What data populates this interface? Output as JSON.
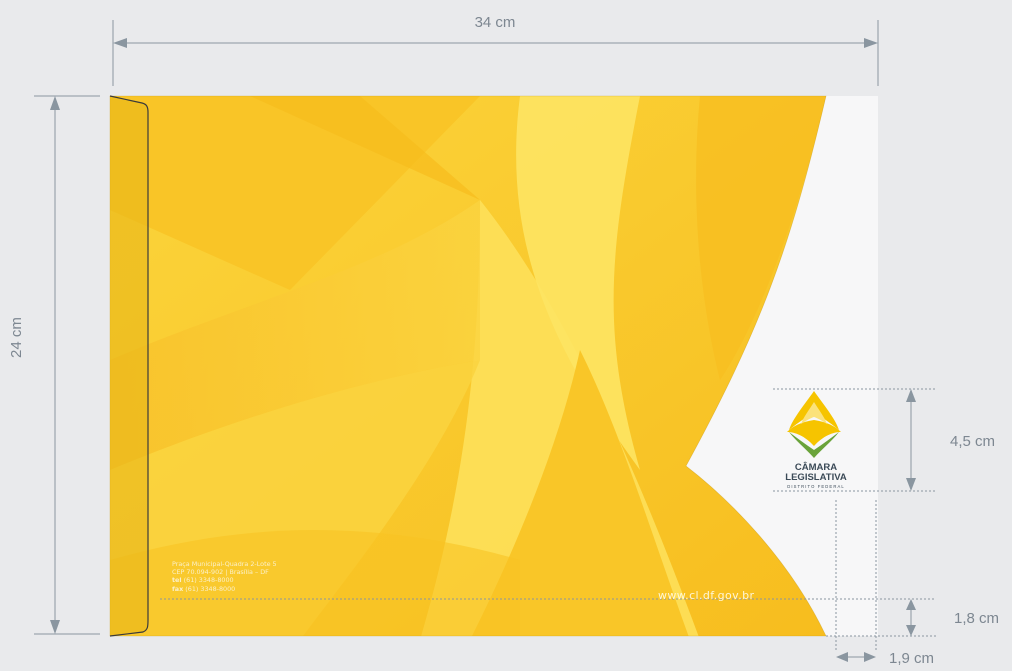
{
  "dimensions": {
    "width_label": "34 cm",
    "height_label": "24 cm",
    "logo_height_label": "4,5 cm",
    "bottom_margin_label": "1,8 cm",
    "right_margin_label": "1,9 cm"
  },
  "envelope": {
    "address_line1": "Praça Municipal-Quadra 2-Lote 5",
    "address_line2": "CEP 70.094-902 | Brasília – DF",
    "tel_label": "tel",
    "tel_value": "(61) 3348-8000",
    "fax_label": "fax",
    "fax_value": "(61) 3348-8000",
    "website": "www.cl.df.gov.br"
  },
  "logo": {
    "line1": "CÂMARA",
    "line2": "LEGISLATIVA",
    "line3": "DISTRITO FEDERAL"
  },
  "colors": {
    "background": "#e9eaec",
    "envelope_yellow": "#f9c623",
    "envelope_light": "#fde15a",
    "logo_yellow": "#f6c400",
    "logo_green": "#6aa33a",
    "dimension_lines": "#8a96a0"
  }
}
